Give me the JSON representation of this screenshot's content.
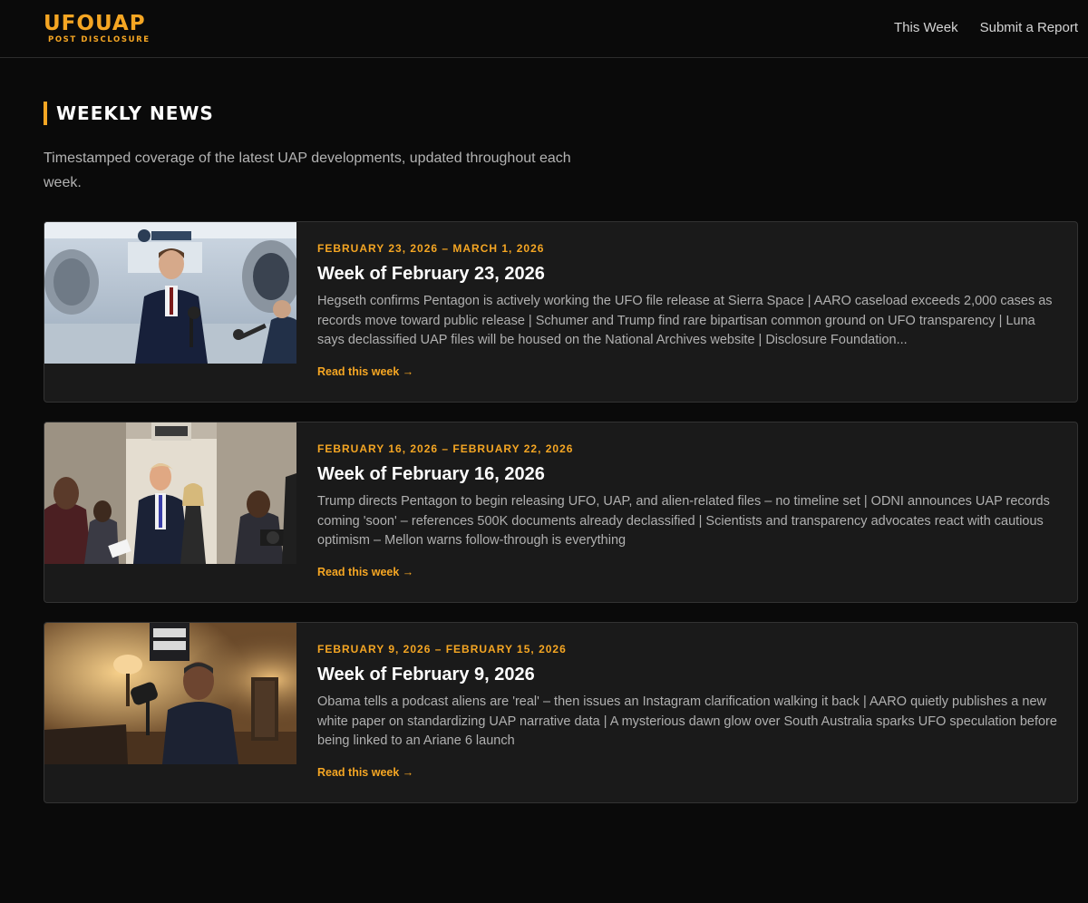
{
  "header": {
    "logo_main": "UFOUAP",
    "logo_sub": "POST DISCLOSURE",
    "nav": [
      {
        "label": "This Week"
      },
      {
        "label": "Submit a Report"
      }
    ]
  },
  "section": {
    "title": "WEEKLY NEWS",
    "description": "Timestamped coverage of the latest UAP developments, updated throughout each week."
  },
  "weeks": [
    {
      "dates": "FEBRUARY 23, 2026 – MARCH 1, 2026",
      "title": "Week of February 23, 2026",
      "summary": "Hegseth confirms Pentagon is actively working the UFO file release at Sierra Space | AARO caseload exceeds 2,000 cases as records move toward public release | Schumer and Trump find rare bipartisan common ground on UFO transparency | Luna says declassified UAP files will be housed on the National Archives website | Disclosure Foundation...",
      "link": "Read this week →",
      "image": "Speaker at podium in space hangar"
    },
    {
      "dates": "FEBRUARY 16, 2026 – FEBRUARY 22, 2026",
      "title": "Week of February 16, 2026",
      "summary": "Trump directs Pentagon to begin releasing UFO, UAP, and alien-related files – no timeline set | ODNI announces UAP records coming 'soon' – references 500K documents already declassified | Scientists and transparency advocates react with cautious optimism – Mellon warns follow-through is everything",
      "link": "Read this week →",
      "image": "Press gaggle aboard aircraft"
    },
    {
      "dates": "FEBRUARY 9, 2026 – FEBRUARY 15, 2026",
      "title": "Week of February 9, 2026",
      "summary": "Obama tells a podcast aliens are 'real' – then issues an Instagram clarification walking it back | AARO quietly publishes a new white paper on standardizing UAP narrative data | A mysterious dawn glow over South Australia sparks UFO speculation before being linked to an Ariane 6 launch",
      "link": "Read this week →",
      "image": "Podcast studio interview"
    }
  ],
  "colors": {
    "accent": "#f5a623",
    "background": "#0a0a0a",
    "card": "#1a1a1a"
  }
}
